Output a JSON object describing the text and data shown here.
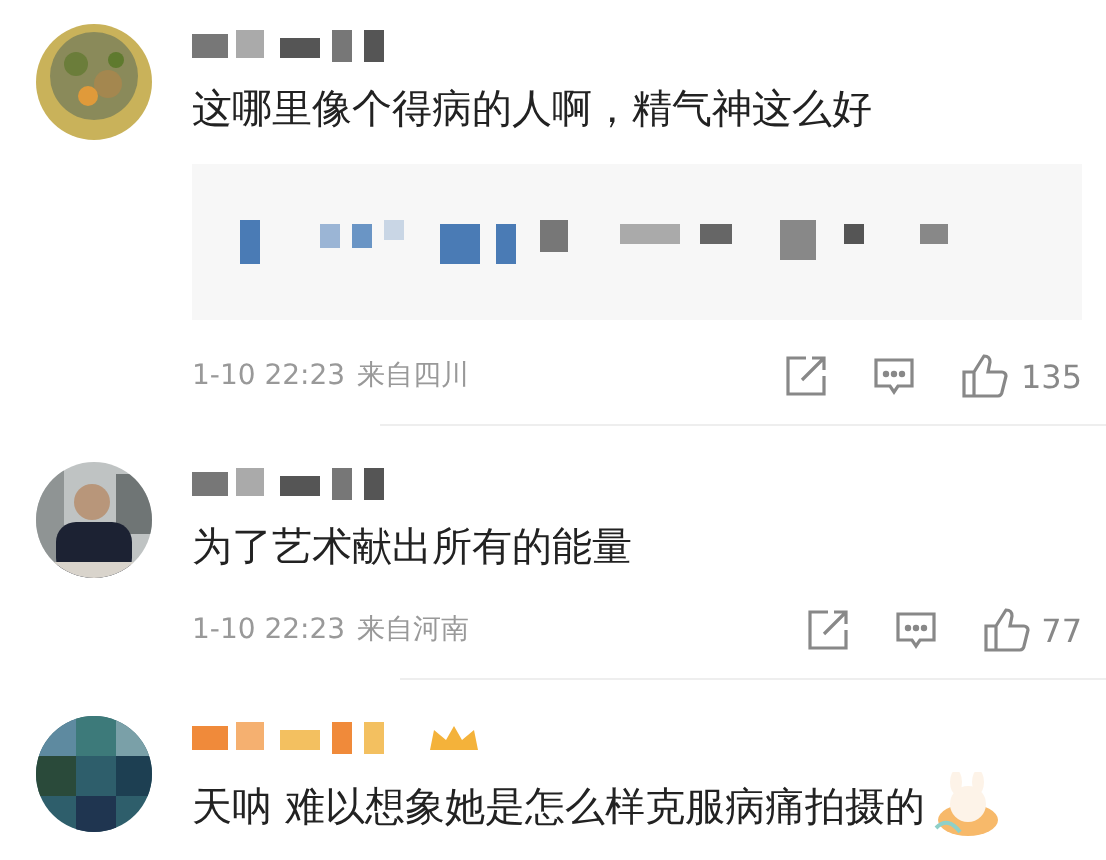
{
  "comments": [
    {
      "text": "这哪里像个得病的人啊，精气神这么好",
      "quoted": true,
      "badge": false,
      "sticker": false,
      "time": "1-10 22:23",
      "location": "来自四川",
      "likes": "135"
    },
    {
      "text": "为了艺术献出所有的能量",
      "quoted": false,
      "badge": false,
      "sticker": false,
      "time": "1-10 22:23",
      "location": "来自河南",
      "likes": "77"
    },
    {
      "text": "天呐 难以想象她是怎么样克服病痛拍摄的",
      "quoted": false,
      "badge": true,
      "sticker": true
    }
  ]
}
